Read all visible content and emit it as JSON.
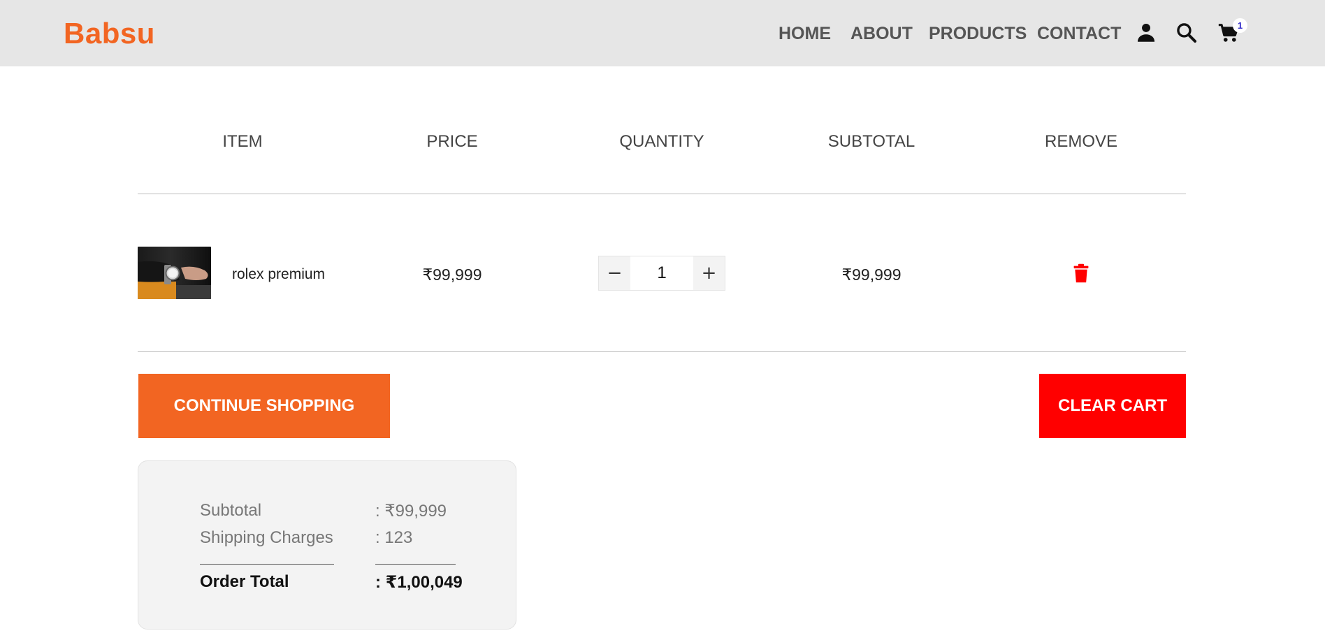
{
  "brand": {
    "logo": "Babsu",
    "color": "#f26522"
  },
  "nav": {
    "links": [
      "HOME",
      "ABOUT",
      "PRODUCTS",
      "CONTACT"
    ],
    "icons": [
      "user-icon",
      "search-icon",
      "cart-icon"
    ],
    "cart_count": "1"
  },
  "table": {
    "headers": [
      "ITEM",
      "PRICE",
      "QUANTITY",
      "SUBTOTAL",
      "REMOVE"
    ]
  },
  "cart_items": [
    {
      "name": "rolex premium",
      "price": "₹99,999",
      "quantity": "1",
      "subtotal": "₹99,999",
      "image": "wristwatch-photo",
      "remove_icon": "trash-icon"
    }
  ],
  "actions": {
    "continue_label": "CONTINUE SHOPPING",
    "clear_label": "CLEAR CART",
    "continue_color": "#f26522",
    "clear_color": "#ff0000"
  },
  "summary": {
    "subtotal_label": "Subtotal",
    "subtotal_value": ": ₹99,999",
    "shipping_label": "Shipping Charges",
    "shipping_value": ": 123",
    "total_label": "Order Total",
    "total_value": ": ₹1,00,049"
  }
}
